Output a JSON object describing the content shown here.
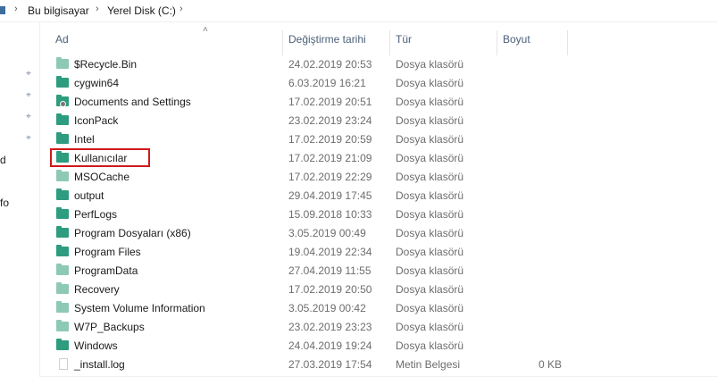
{
  "breadcrumb": {
    "items": [
      "Bu bilgisayar",
      "Yerel Disk (C:)"
    ]
  },
  "left_pane": {
    "partial_labels": [
      "d",
      "fo"
    ]
  },
  "columns": {
    "name": "Ad",
    "date": "Değiştirme tarihi",
    "type": "Tür",
    "size": "Boyut"
  },
  "rows": [
    {
      "name": "$Recycle.Bin",
      "date": "24.02.2019 20:53",
      "type": "Dosya klasörü",
      "size": "",
      "icon": "folder-hidden-icon"
    },
    {
      "name": "cygwin64",
      "date": "6.03.2019 16:21",
      "type": "Dosya klasörü",
      "size": "",
      "icon": "folder-icon"
    },
    {
      "name": "Documents and Settings",
      "date": "17.02.2019 20:51",
      "type": "Dosya klasörü",
      "size": "",
      "icon": "folder-shortcut-icon"
    },
    {
      "name": "IconPack",
      "date": "23.02.2019 23:24",
      "type": "Dosya klasörü",
      "size": "",
      "icon": "folder-icon"
    },
    {
      "name": "Intel",
      "date": "17.02.2019 20:59",
      "type": "Dosya klasörü",
      "size": "",
      "icon": "folder-icon"
    },
    {
      "name": "Kullanıcılar",
      "date": "17.02.2019 21:09",
      "type": "Dosya klasörü",
      "size": "",
      "icon": "folder-icon"
    },
    {
      "name": "MSOCache",
      "date": "17.02.2019 22:29",
      "type": "Dosya klasörü",
      "size": "",
      "icon": "folder-hidden-icon"
    },
    {
      "name": "output",
      "date": "29.04.2019 17:45",
      "type": "Dosya klasörü",
      "size": "",
      "icon": "folder-icon"
    },
    {
      "name": "PerfLogs",
      "date": "15.09.2018 10:33",
      "type": "Dosya klasörü",
      "size": "",
      "icon": "folder-icon"
    },
    {
      "name": "Program Dosyaları (x86)",
      "date": "3.05.2019 00:49",
      "type": "Dosya klasörü",
      "size": "",
      "icon": "folder-icon"
    },
    {
      "name": "Program Files",
      "date": "19.04.2019 22:34",
      "type": "Dosya klasörü",
      "size": "",
      "icon": "folder-icon"
    },
    {
      "name": "ProgramData",
      "date": "27.04.2019 11:55",
      "type": "Dosya klasörü",
      "size": "",
      "icon": "folder-hidden-icon"
    },
    {
      "name": "Recovery",
      "date": "17.02.2019 20:50",
      "type": "Dosya klasörü",
      "size": "",
      "icon": "folder-hidden-icon"
    },
    {
      "name": "System Volume Information",
      "date": "3.05.2019 00:42",
      "type": "Dosya klasörü",
      "size": "",
      "icon": "folder-hidden-icon"
    },
    {
      "name": "W7P_Backups",
      "date": "23.02.2019 23:23",
      "type": "Dosya klasörü",
      "size": "",
      "icon": "folder-hidden-icon"
    },
    {
      "name": "Windows",
      "date": "24.04.2019 19:24",
      "type": "Dosya klasörü",
      "size": "",
      "icon": "folder-icon"
    },
    {
      "name": "_install.log",
      "date": "27.03.2019 17:54",
      "type": "Metin Belgesi",
      "size": "0 KB",
      "icon": "text-file-icon"
    }
  ],
  "colors": {
    "folder": "#2e9c7e",
    "folder_hidden": "#8dc9b6",
    "highlight_box": "#d0191a",
    "header_text": "#4c607a"
  }
}
